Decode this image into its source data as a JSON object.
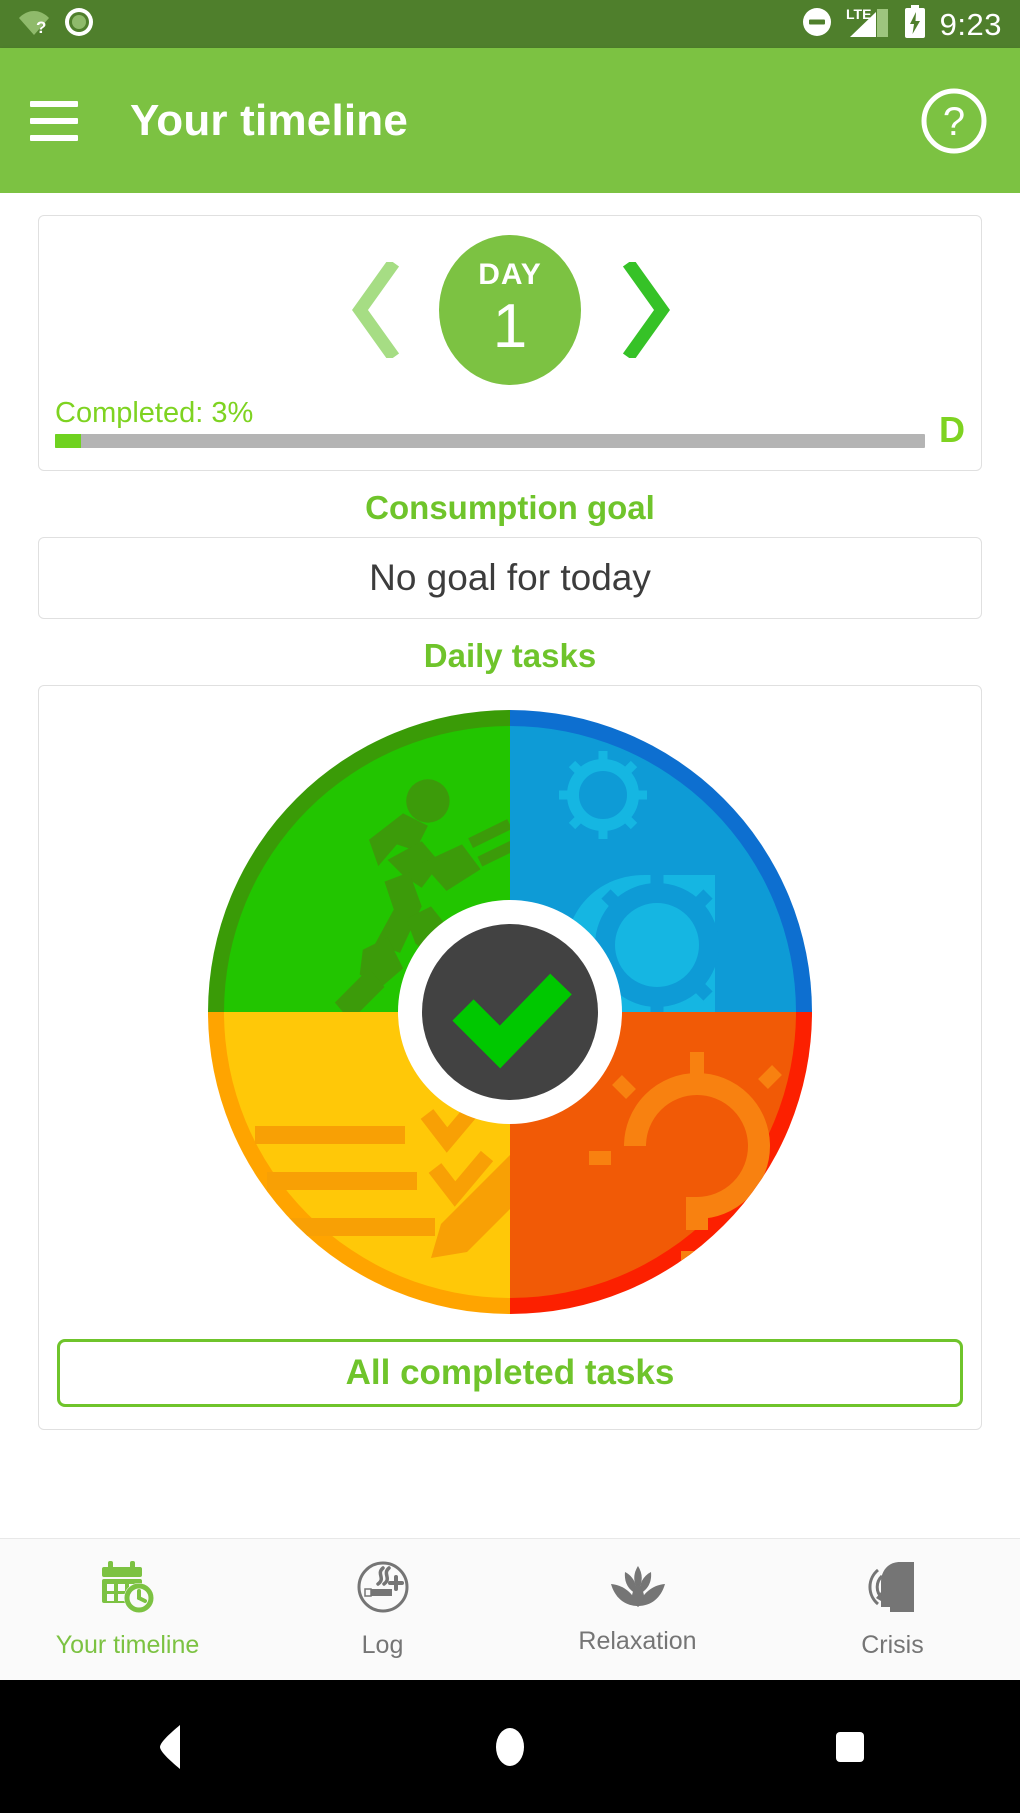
{
  "statusbar": {
    "time": "9:23",
    "icons": [
      "wifi-question-icon",
      "record-dot-icon",
      "do-not-disturb-icon",
      "lte-signal-icon",
      "battery-charging-icon"
    ],
    "network_label": "LTE",
    "background_color": "#4f7f2c"
  },
  "appbar": {
    "title": "Your timeline",
    "menu_icon": "hamburger-menu-icon",
    "help_icon": "help-circle-icon",
    "background_color": "#7cc242"
  },
  "day_card": {
    "prev_icon": "chevron-left-icon",
    "next_icon": "chevron-right-icon",
    "day_label": "DAY",
    "day_number": "1",
    "progress_label": "Completed: 3%",
    "progress_percent": 3,
    "progress_fill_color": "#6fd220",
    "progress_track_color": "#b4b4b4",
    "side_label": "D"
  },
  "consumption": {
    "heading": "Consumption goal",
    "value": "No goal for today"
  },
  "daily_tasks": {
    "heading": "Daily tasks",
    "wheel": {
      "center_icon": "check-mark-icon",
      "center_circle_color": "#424242",
      "check_color": "#00c800",
      "quadrants": [
        {
          "position": "top-left",
          "name": "physical-activity-quadrant",
          "icon": "running-person-icon",
          "fill": "#22c500",
          "rim": "#3a9b07",
          "icon_color": "#3c9b0a"
        },
        {
          "position": "top-right",
          "name": "knowledge-quadrant",
          "icon": "head-with-gears-icon",
          "fill": "#0e9bd6",
          "rim": "#0d6fd0",
          "icon_color": "#15b6e2"
        },
        {
          "position": "bottom-right",
          "name": "motivation-quadrant",
          "icon": "lightbulb-question-icon",
          "fill": "#f15a06",
          "rim": "#fc2000",
          "icon_color": "#f88110"
        },
        {
          "position": "bottom-left",
          "name": "checklist-quadrant",
          "icon": "checklist-pencil-icon",
          "fill": "#ffc808",
          "rim": "#ffa400",
          "icon_color": "#f8a005"
        }
      ]
    },
    "all_completed_button": "All completed tasks"
  },
  "bottom_nav": {
    "items": [
      {
        "label": "Your timeline",
        "icon": "calendar-clock-icon",
        "active": true
      },
      {
        "label": "Log",
        "icon": "cigarette-plus-icon",
        "active": false
      },
      {
        "label": "Relaxation",
        "icon": "lotus-flower-icon",
        "active": false
      },
      {
        "label": "Crisis",
        "icon": "head-soundwave-icon",
        "active": false
      }
    ],
    "active_color": "#7cc242",
    "inactive_color": "#757575"
  },
  "android_nav": {
    "back": "back-triangle-icon",
    "home": "home-circle-icon",
    "recents": "recents-square-icon"
  }
}
